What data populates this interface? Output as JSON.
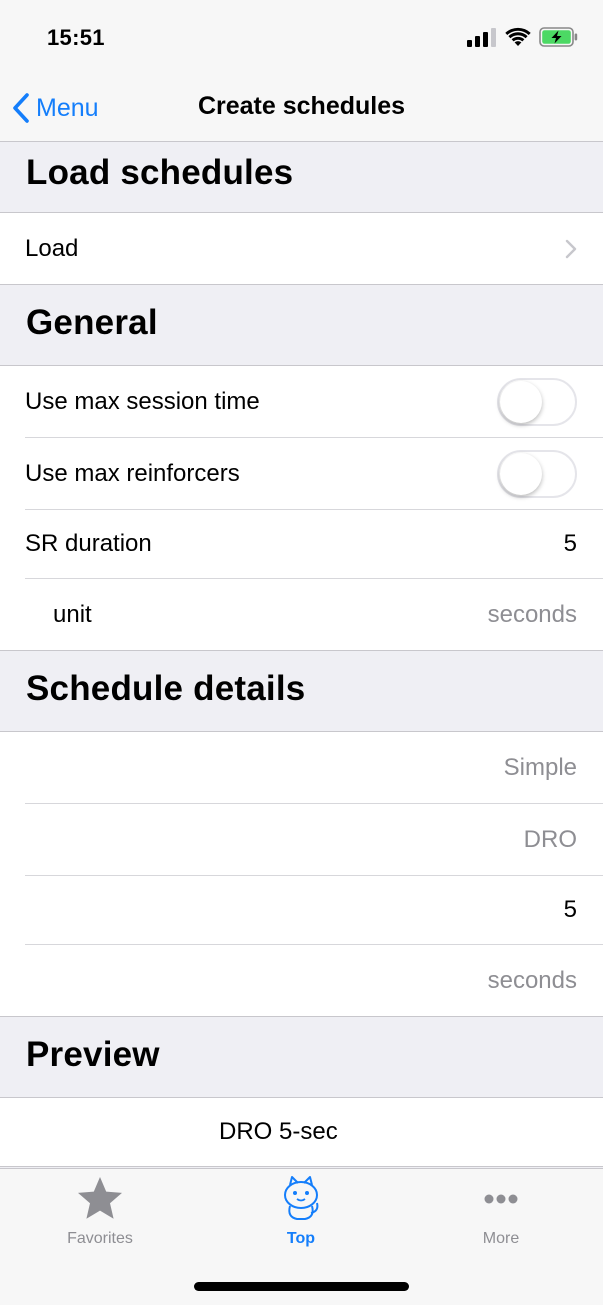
{
  "status_bar": {
    "time": "15:51",
    "signal_icon": "cellular-signal-icon",
    "wifi_icon": "wifi-icon",
    "battery_icon": "battery-charging-icon"
  },
  "nav": {
    "back_label": "Menu",
    "title": "Create schedules"
  },
  "sections": {
    "load": {
      "header": "Load schedules",
      "rows": [
        {
          "label": "Load"
        }
      ]
    },
    "general": {
      "header": "General",
      "rows": [
        {
          "label": "Use max session time",
          "toggle_on": false
        },
        {
          "label": "Use max reinforcers",
          "toggle_on": false
        },
        {
          "label": "SR duration",
          "value": "5"
        },
        {
          "label": "unit",
          "value": "seconds"
        }
      ]
    },
    "schedule_details": {
      "header": "Schedule details",
      "rows": [
        {
          "value": "Simple"
        },
        {
          "value": "DRO"
        },
        {
          "value": "5"
        },
        {
          "value": "seconds"
        }
      ]
    },
    "preview": {
      "header": "Preview",
      "text": "DRO 5-sec"
    }
  },
  "tab_bar": {
    "tabs": [
      {
        "label": "Favorites",
        "icon": "star-icon",
        "active": false
      },
      {
        "label": "Top",
        "icon": "cat-mascot-icon",
        "active": true
      },
      {
        "label": "More",
        "icon": "more-dots-icon",
        "active": false
      }
    ]
  },
  "colors": {
    "accent": "#147efb",
    "secondary_text": "#8e8e93",
    "grouped_background": "#efeff4"
  }
}
